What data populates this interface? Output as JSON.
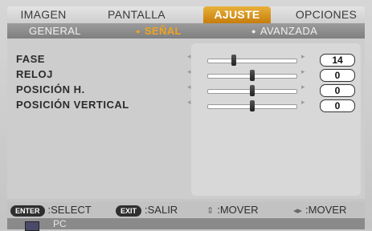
{
  "tabs": [
    {
      "label": "IMAGEN"
    },
    {
      "label": "PANTALLA"
    },
    {
      "label": "AJUSTE"
    },
    {
      "label": "OPCIONES"
    }
  ],
  "subtabs": [
    {
      "label": "GENERAL"
    },
    {
      "label": "SEÑAL"
    },
    {
      "label": "AVANZADA"
    }
  ],
  "settings": [
    {
      "label": "FASE",
      "value": "14"
    },
    {
      "label": "RELOJ",
      "value": "0"
    },
    {
      "label": "POSICIÓN H.",
      "value": "0"
    },
    {
      "label": "POSICIÓN VERTICAL",
      "value": "0"
    }
  ],
  "footer": {
    "enter_key": "ENTER",
    "enter_action": ":SELECT",
    "exit_key": "EXIT",
    "exit_action": ":SALIR",
    "move_v_action": ":MOVER",
    "move_h_action": ":MOVER"
  },
  "source": {
    "label": "PC"
  },
  "colors": {
    "accent": "#e0a030"
  }
}
